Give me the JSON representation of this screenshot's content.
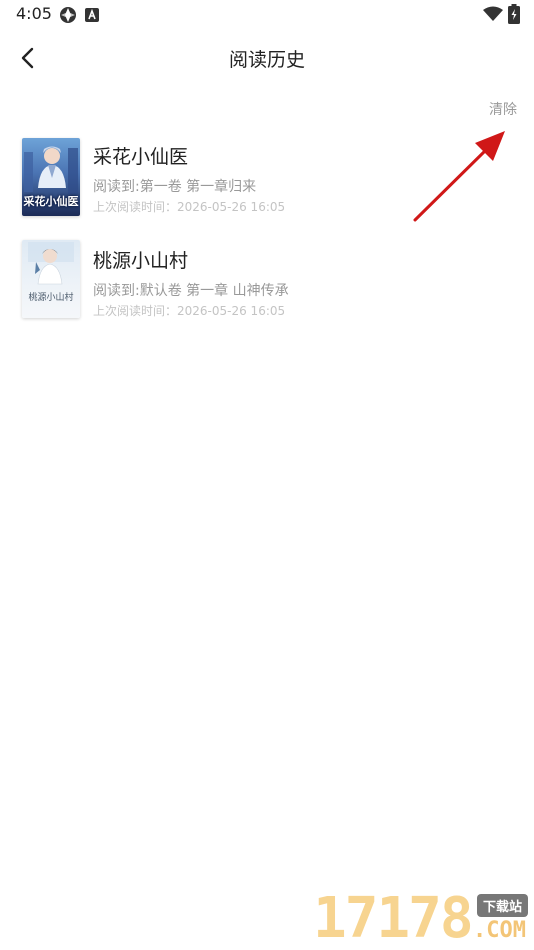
{
  "status_bar": {
    "time": "4:05"
  },
  "header": {
    "title": "阅读历史"
  },
  "actions": {
    "clear_label": "清除"
  },
  "history": [
    {
      "title": "采花小仙医",
      "progress": "阅读到:第一卷 第一章归来",
      "last_read": "上次阅读时间：2026-05-26 16:05",
      "cover_text": "采花小仙医"
    },
    {
      "title": "桃源小山村",
      "progress": "阅读到:默认卷 第一章  山神传承",
      "last_read": "上次阅读时间：2026-05-26 16:05",
      "cover_text": "桃源小山村"
    }
  ],
  "watermark": {
    "digits": "17178",
    "tag": "下载站",
    "suffix": ".COM"
  },
  "colors": {
    "annotation_arrow": "#d01818",
    "muted_text": "#999999",
    "faint_text": "#c4c4c4"
  }
}
